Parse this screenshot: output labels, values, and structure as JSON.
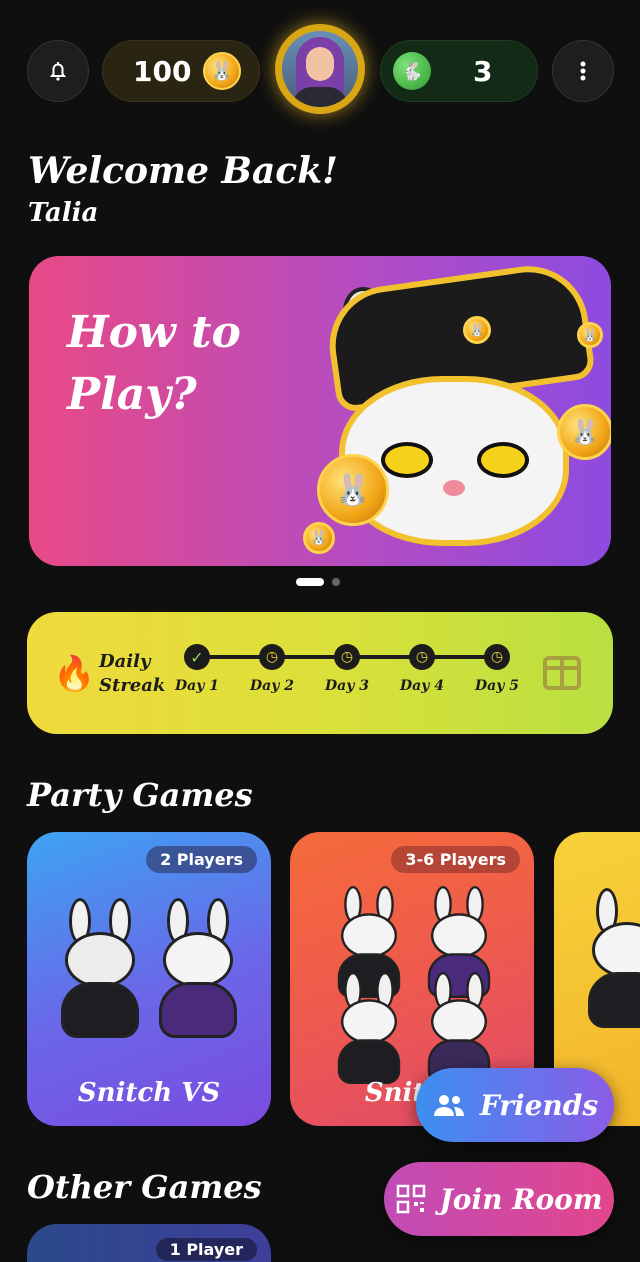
{
  "header": {
    "coin_balance": "100",
    "game_tokens": "3"
  },
  "welcome": {
    "greeting": "Welcome Back!",
    "username": "Talia"
  },
  "banner": {
    "title": "How to Play?"
  },
  "carousel": {
    "active_index": 0,
    "count": 2
  },
  "streak": {
    "label": "Daily Streak",
    "days": [
      {
        "label": "Day 1",
        "completed": true
      },
      {
        "label": "Day 2",
        "completed": false
      },
      {
        "label": "Day 3",
        "completed": false
      },
      {
        "label": "Day 4",
        "completed": false
      },
      {
        "label": "Day 5",
        "completed": false
      }
    ]
  },
  "party_games": {
    "title": "Party Games",
    "cards": [
      {
        "title": "Snitch VS",
        "players": "2 Players"
      },
      {
        "title": "Snitch",
        "players": "3-6 Players"
      }
    ]
  },
  "other_games": {
    "title": "Other Games",
    "cards": [
      {
        "players": "1 Player"
      }
    ]
  },
  "fabs": {
    "friends_label": "Friends",
    "join_label": "Join Room"
  },
  "colors": {
    "background": "#0f0f0f",
    "coin_gold": "#f2a516",
    "streak_yellow": "#f0da3c",
    "banner_pink": "#e84a86",
    "banner_purple": "#8d4be0"
  },
  "icons": {
    "notifications": "bell-icon",
    "menu": "more-vertical-icon",
    "streak": "flame-icon",
    "reward": "gift-icon",
    "friends": "users-icon",
    "join": "qr-code-icon"
  }
}
